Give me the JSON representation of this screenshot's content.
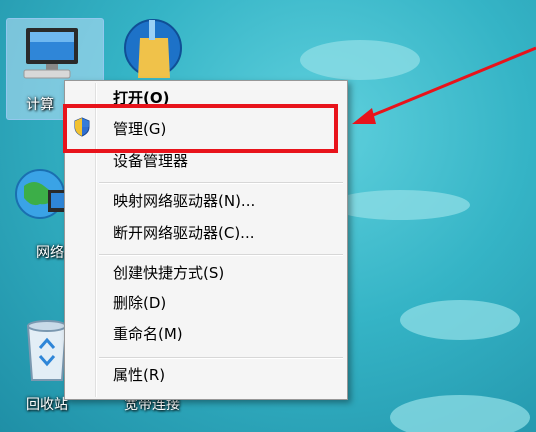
{
  "desktop": {
    "icons": [
      {
        "name": "computer",
        "label": "计算"
      },
      {
        "name": "cleaner",
        "label": ""
      },
      {
        "name": "network",
        "label": "网络"
      },
      {
        "name": "recycle-bin",
        "label": "回收站"
      },
      {
        "name": "broadband",
        "label": "宽带连接"
      }
    ]
  },
  "context_menu": {
    "items": [
      {
        "label": "打开(O)",
        "bold": true
      },
      {
        "label": "管理(G)"
      },
      {
        "label": "设备管理器"
      },
      {
        "label": "映射网络驱动器(N)..."
      },
      {
        "label": "断开网络驱动器(C)..."
      },
      {
        "label": "创建快捷方式(S)"
      },
      {
        "label": "删除(D)"
      },
      {
        "label": "重命名(M)"
      },
      {
        "label": "属性(R)"
      }
    ]
  },
  "colors": {
    "highlight_box": "#e8131b",
    "arrow": "#e8131b",
    "desktop_bg": "#35b4c6"
  }
}
